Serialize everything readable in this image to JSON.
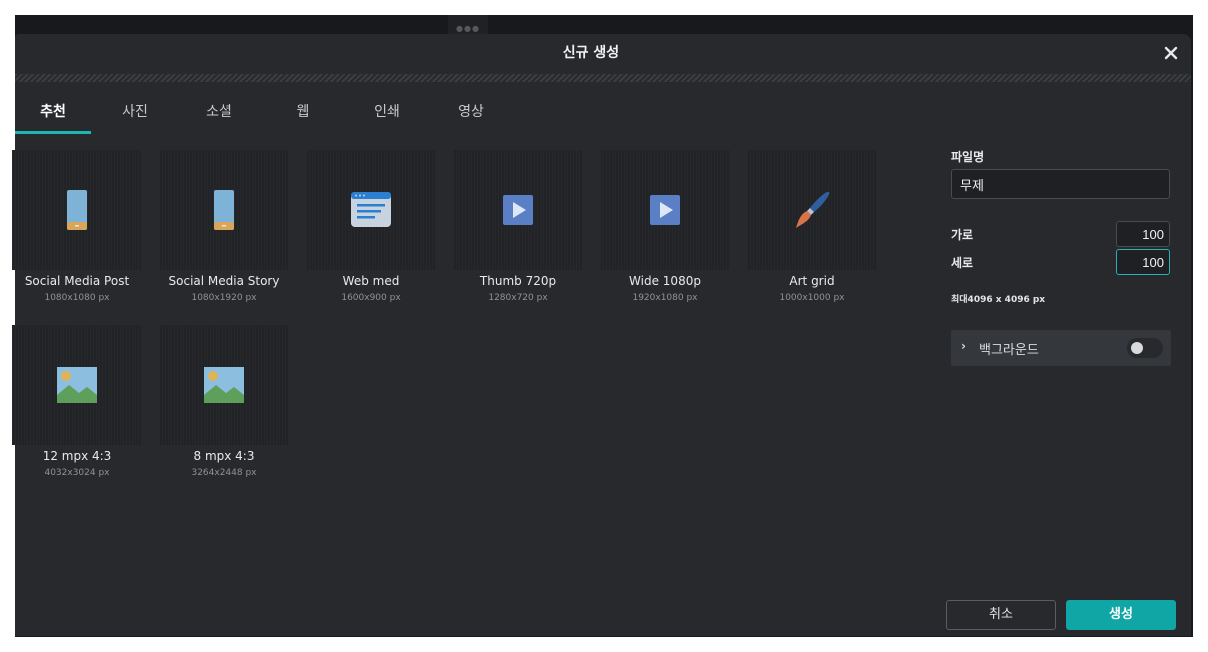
{
  "dialog": {
    "title": "신규 생성",
    "close_icon": "close-icon"
  },
  "tabs": [
    {
      "label": "추천",
      "active": true
    },
    {
      "label": "사진",
      "active": false
    },
    {
      "label": "소셜",
      "active": false
    },
    {
      "label": "웹",
      "active": false
    },
    {
      "label": "인쇄",
      "active": false
    },
    {
      "label": "영상",
      "active": false
    }
  ],
  "presets": [
    {
      "name": "Social Media Post",
      "dims": "1080x1080 px",
      "icon": "phone-icon"
    },
    {
      "name": "Social Media Story",
      "dims": "1080x1920 px",
      "icon": "phone-icon"
    },
    {
      "name": "Web med",
      "dims": "1600x900 px",
      "icon": "web-page-icon"
    },
    {
      "name": "Thumb 720p",
      "dims": "1280x720 px",
      "icon": "video-play-icon"
    },
    {
      "name": "Wide 1080p",
      "dims": "1920x1080 px",
      "icon": "video-play-icon"
    },
    {
      "name": "Art grid",
      "dims": "1000x1000 px",
      "icon": "paintbrush-icon"
    },
    {
      "name": "12 mpx 4:3",
      "dims": "4032x3024 px",
      "icon": "landscape-photo-icon"
    },
    {
      "name": "8 mpx 4:3",
      "dims": "3264x2448 px",
      "icon": "landscape-photo-icon"
    }
  ],
  "panel": {
    "filename_label": "파일명",
    "filename_value": "무제",
    "width_label": "가로",
    "width_value": "100",
    "height_label": "세로",
    "height_value": "100",
    "max_note": "최대4096 x 4096 px",
    "background_label": "백그라운드",
    "background_enabled": false
  },
  "buttons": {
    "cancel": "취소",
    "create": "생성"
  },
  "colors": {
    "accent": "#1fb5b2",
    "create_button": "#10a6a6",
    "dialog_bg": "#27292d"
  }
}
